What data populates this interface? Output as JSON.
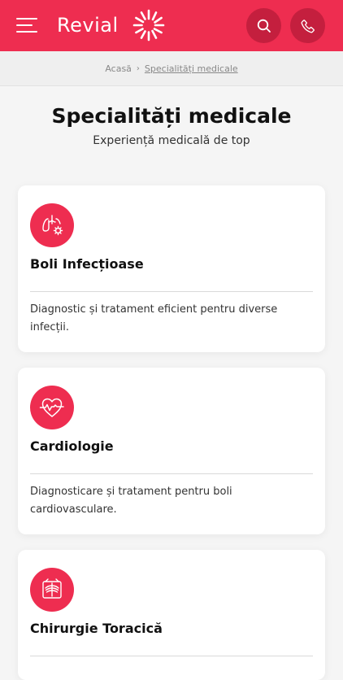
{
  "header": {
    "brand": "Revial",
    "menu_icon": "hamburger-menu-icon",
    "search_icon": "search-icon",
    "phone_icon": "phone-icon",
    "background": "#ee2d50",
    "button_color": "#c41f3e"
  },
  "breadcrumb": {
    "home": "Acasă",
    "separator": "›",
    "current": "Specialități medicale"
  },
  "page": {
    "title": "Specialități medicale",
    "subtitle": "Experiență medicală de top"
  },
  "cards": [
    {
      "icon": "lungs-virus-icon",
      "title": "Boli Infecțioase",
      "description": "Diagnostic și tratament eficient pentru diverse infecții."
    },
    {
      "icon": "heart-pulse-icon",
      "title": "Cardiologie",
      "description": "Diagnosticare și tratament pentru boli cardiovasculare."
    },
    {
      "icon": "chest-xray-icon",
      "title": "Chirurgie Toracică",
      "description": ""
    }
  ]
}
